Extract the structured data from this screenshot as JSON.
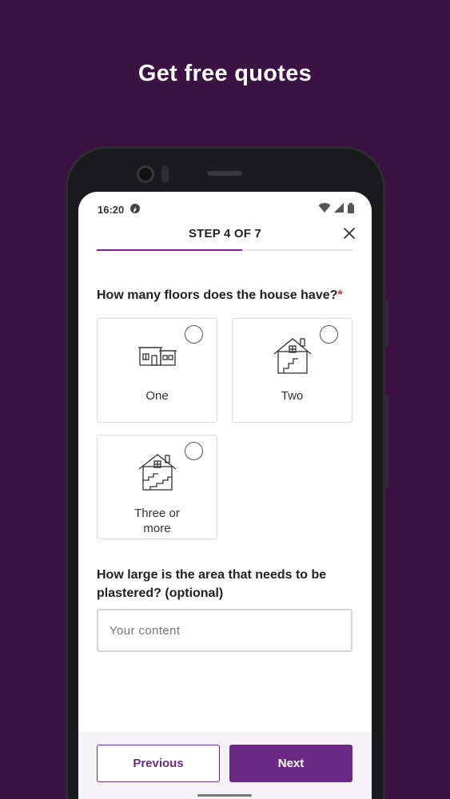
{
  "promo": {
    "title": "Get free quotes"
  },
  "status_bar": {
    "time": "16:20",
    "icons": [
      "notification-icon",
      "wifi-icon",
      "signal-icon",
      "battery-icon"
    ]
  },
  "header": {
    "step_label": "STEP 4 OF 7",
    "progress": 0.57,
    "close_icon": "close-icon"
  },
  "question_floors": {
    "label": "How many floors does the house have?",
    "required_mark": "*",
    "options": [
      {
        "label": "One",
        "icon": "single-storey-house-icon",
        "selected": false
      },
      {
        "label": "Two",
        "icon": "two-storey-house-icon",
        "selected": false
      },
      {
        "label": "Three or more",
        "icon": "multi-storey-house-icon",
        "selected": false
      }
    ]
  },
  "question_area": {
    "label": "How large is the area that needs to be plastered? (optional)",
    "placeholder": "Your content",
    "value": ""
  },
  "footer": {
    "previous_label": "Previous",
    "next_label": "Next"
  },
  "colors": {
    "background": "#3a1342",
    "accent": "#6d2a85",
    "required": "#dd3333"
  }
}
